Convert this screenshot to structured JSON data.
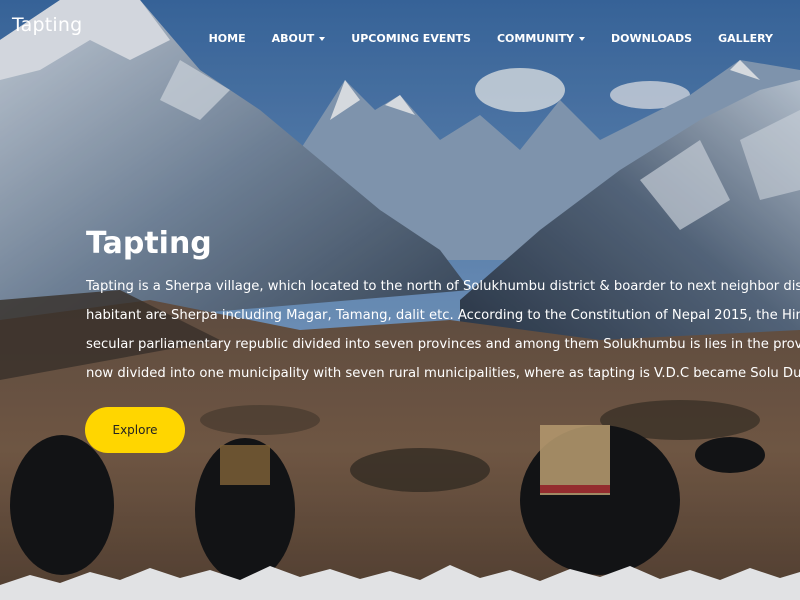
{
  "brand": "Tapting",
  "nav": [
    {
      "label": "HOME",
      "dropdown": false
    },
    {
      "label": "ABOUT",
      "dropdown": true
    },
    {
      "label": "UPCOMING EVENTS",
      "dropdown": false
    },
    {
      "label": "COMMUNITY",
      "dropdown": true
    },
    {
      "label": "DOWNLOADS",
      "dropdown": false
    },
    {
      "label": "GALLERY",
      "dropdown": false
    }
  ],
  "hero": {
    "title": "Tapting",
    "lines": [
      "Tapting is a Sherpa village, which located to the north of Solukhumbu district & boarder to next neighbor district Okhaldung. W",
      "habitant are Sherpa including Magar, Tamang, dalit etc. According to the Constitution of Nepal 2015, the Himalayan kingdom a",
      "secular parliamentary republic divided into seven provinces and among them Solukhumbu is lies in the province one. Similarly",
      "now divided into one municipality with seven rural municipalities, where as tapting is V.D.C became Solu Dudhkunda Municipa"
    ],
    "button_label": "Explore"
  },
  "colors": {
    "accent": "#ffd600",
    "text": "#ffffff"
  }
}
